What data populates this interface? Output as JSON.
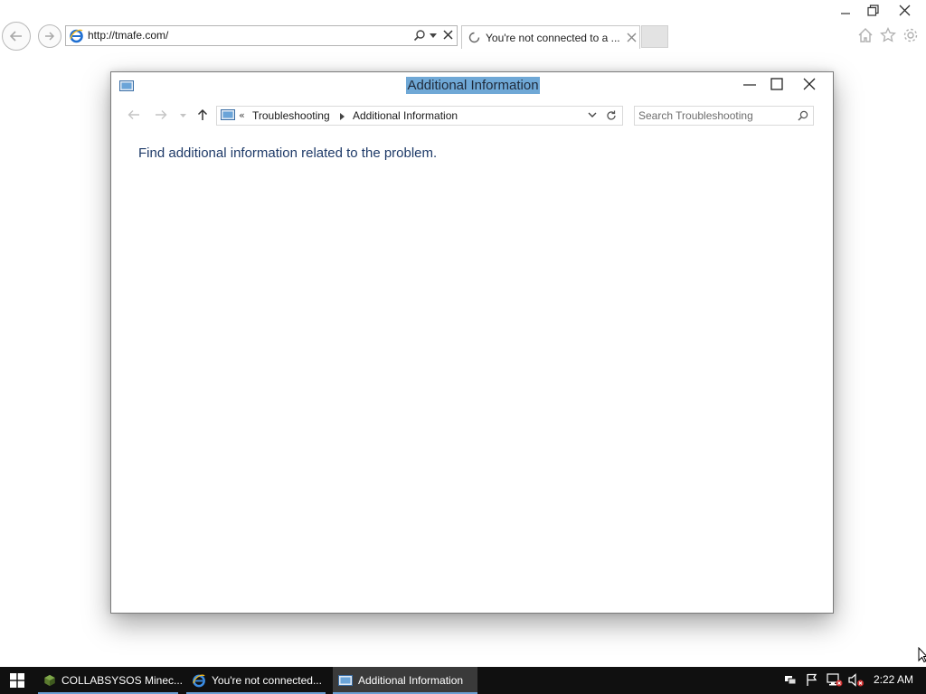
{
  "browser": {
    "address_url": "http://tmafe.com/",
    "tab_title": "You're not connected to a ...",
    "window_controls": {
      "minimize": "minimize",
      "restore": "restore",
      "close": "close"
    }
  },
  "dialog": {
    "title": "Additional Information",
    "breadcrumb": {
      "overflow": "«",
      "items": [
        "Troubleshooting",
        "Additional Information"
      ]
    },
    "search_placeholder": "Search Troubleshooting",
    "body_text": "Find additional information related to the problem."
  },
  "taskbar": {
    "items": [
      {
        "label": "COLLABSYSOS Minec...",
        "icon": "minecraft-icon",
        "active": false
      },
      {
        "label": "You're not connected...",
        "icon": "ie-icon",
        "active": false
      },
      {
        "label": "Additional Information",
        "icon": "control-panel-icon",
        "active": true
      }
    ],
    "clock": "2:22 AM"
  },
  "colors": {
    "title_highlight": "#6fa8d6",
    "body_text": "#1e3a68",
    "taskbar_bg": "#101010",
    "active_task_bg": "#3a3a3a"
  }
}
